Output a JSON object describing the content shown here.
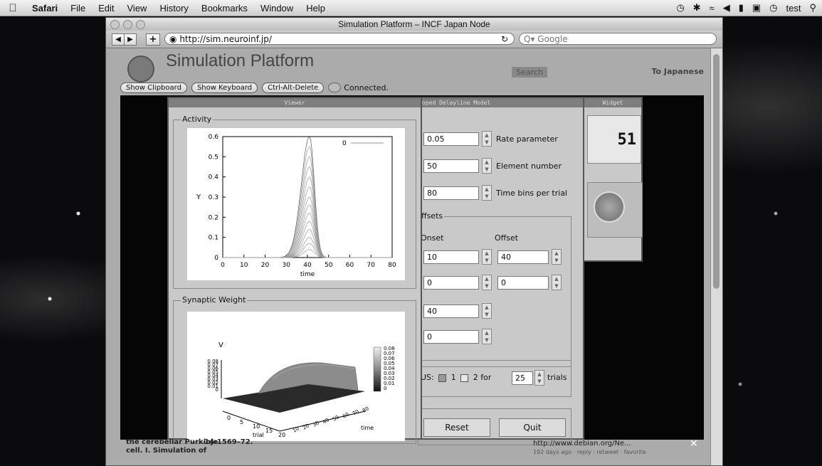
{
  "menubar": {
    "items": [
      "Safari",
      "File",
      "Edit",
      "View",
      "History",
      "Bookmarks",
      "Window",
      "Help"
    ],
    "user": "test"
  },
  "browser": {
    "window_title": "Simulation Platform – INCF Japan Node",
    "url": "http://sim.neuroinf.jp/",
    "search_placeholder": "Q▾ Google"
  },
  "site": {
    "title": "Simulation Platform",
    "search_button": "Search",
    "to_japanese": "To Japanese",
    "vnc_buttons": [
      "Show Clipboard",
      "Show Keyboard",
      "Ctrl-Alt-Delete"
    ],
    "vnc_status": "Connected.",
    "footer_left": [
      "the cerebellar Purkinje",
      "cell. I. Simulation of"
    ],
    "footer_mid": "14:1569–72.",
    "footer_right_link": "http://www.debian.org/Ne...",
    "footer_right_meta": "192 days ago · reply · retweet · favorite"
  },
  "viewer": {
    "title": "Viewer",
    "activity_label": "Activity",
    "synaptic_label": "Synaptic Weight"
  },
  "model": {
    "title": "oped Delayline Model",
    "rate": {
      "value": "0.05",
      "label": "Rate parameter"
    },
    "elements": {
      "value": "50",
      "label": "Element number"
    },
    "bins": {
      "value": "80",
      "label": "Time bins per trial"
    },
    "offsets_label": "ffsets",
    "onset_header": "Onset",
    "offset_header": "Offset",
    "onset_values": [
      "10",
      "0",
      "40",
      "0"
    ],
    "offset_values": [
      "40",
      "0"
    ],
    "us_label": "US:",
    "us_options": [
      "1",
      "2"
    ],
    "for_label": "for",
    "trials_value": "25",
    "trials_label": "trials",
    "reset": "Reset",
    "quit": "Quit"
  },
  "widget": {
    "title": "Widget",
    "display": "51"
  },
  "chart_data": [
    {
      "type": "line",
      "title": "",
      "xlabel": "time",
      "ylabel": "Y",
      "xlim": [
        0,
        80
      ],
      "ylim": [
        0,
        0.6
      ],
      "xticks": [
        "0",
        "10",
        "20",
        "30",
        "40",
        "50",
        "60",
        "70",
        "80"
      ],
      "yticks": [
        "0",
        "0.1",
        "0.2",
        "0.3",
        "0.4",
        "0.5",
        "0.6"
      ],
      "legend": "0",
      "peak_x": 41,
      "peak_levels": [
        0.6,
        0.55,
        0.5,
        0.45,
        0.4,
        0.35,
        0.3,
        0.26,
        0.22,
        0.18,
        0.14,
        0.1,
        0.07,
        0.04
      ]
    },
    {
      "type": "surface",
      "zlabel": "V",
      "colorbar_ticks": [
        "0.08",
        "0.07",
        "0.06",
        "0.05",
        "0.04",
        "0.03",
        "0.02",
        "0.01",
        "0"
      ],
      "zticks": [
        "0.08",
        "0.07",
        "0.06",
        "0.05",
        "0.04",
        "0.03",
        "0.02",
        "0.01",
        "0"
      ],
      "xticks": [
        "0",
        "5",
        "10",
        "15",
        "20"
      ],
      "xlabel": "trial",
      "ylabel": "time",
      "yticks": [
        "10",
        "20",
        "30",
        "40",
        "50",
        "60",
        "70",
        "80"
      ]
    }
  ]
}
